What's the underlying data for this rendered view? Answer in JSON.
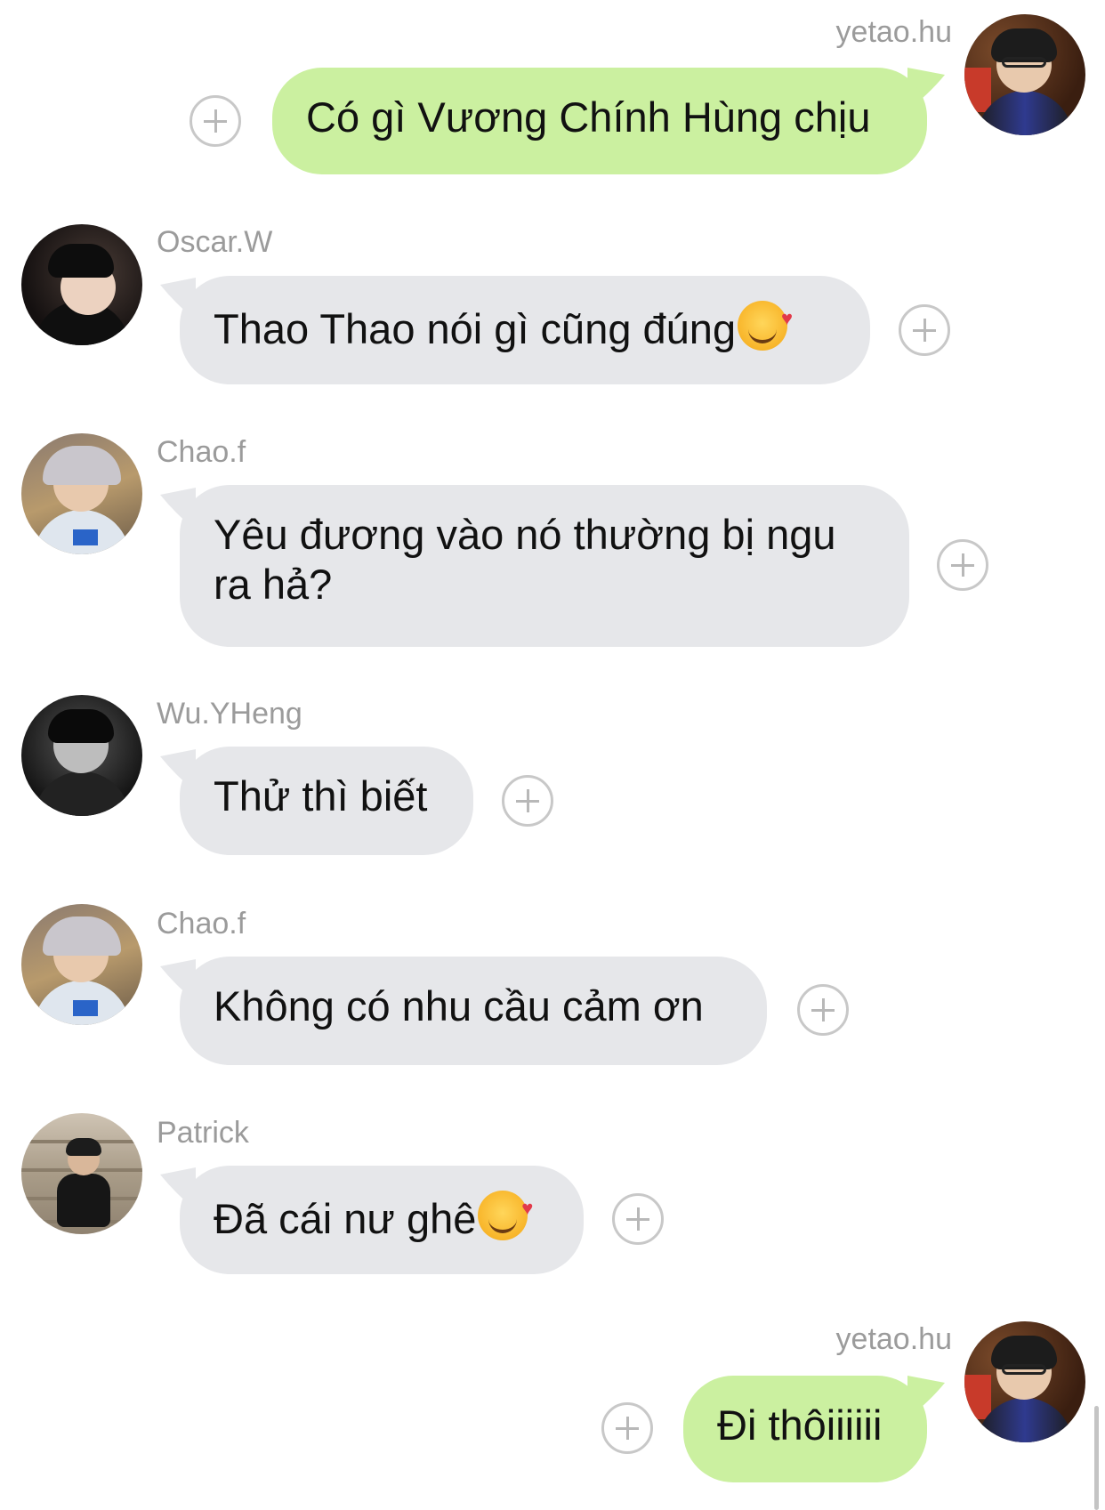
{
  "messages": [
    {
      "id": "m1",
      "sender": "yetao.hu",
      "direction": "outgoing",
      "text": "Có gì Vương Chính Hùng chịu",
      "emoji": ""
    },
    {
      "id": "m2",
      "sender": "Oscar.W",
      "direction": "incoming",
      "text": "Thao Thao nói gì cũng đúng",
      "emoji": "smiling-face-with-hearts"
    },
    {
      "id": "m3",
      "sender": "Chao.f",
      "direction": "incoming",
      "text": "Yêu đương vào nó thường bị ngu ra hả?",
      "emoji": ""
    },
    {
      "id": "m4",
      "sender": "Wu.YHeng",
      "direction": "incoming",
      "text": "Thử thì biết",
      "emoji": ""
    },
    {
      "id": "m5",
      "sender": "Chao.f",
      "direction": "incoming",
      "text": "Không có nhu cầu cảm ơn",
      "emoji": ""
    },
    {
      "id": "m6",
      "sender": "Patrick",
      "direction": "incoming",
      "text": "Đã cái nư ghê",
      "emoji": "smiling-face-with-hearts"
    },
    {
      "id": "m7",
      "sender": "yetao.hu",
      "direction": "outgoing",
      "text": "Đi thôiiiiii",
      "emoji": ""
    }
  ],
  "icons": {
    "add": "plus-circle-icon",
    "reaction_emoji": "smiling-face-with-hearts-emoji"
  },
  "colors": {
    "outgoing_bubble": "#cbf0a0",
    "incoming_bubble": "#e6e7ea",
    "username": "#9b9b9b"
  }
}
